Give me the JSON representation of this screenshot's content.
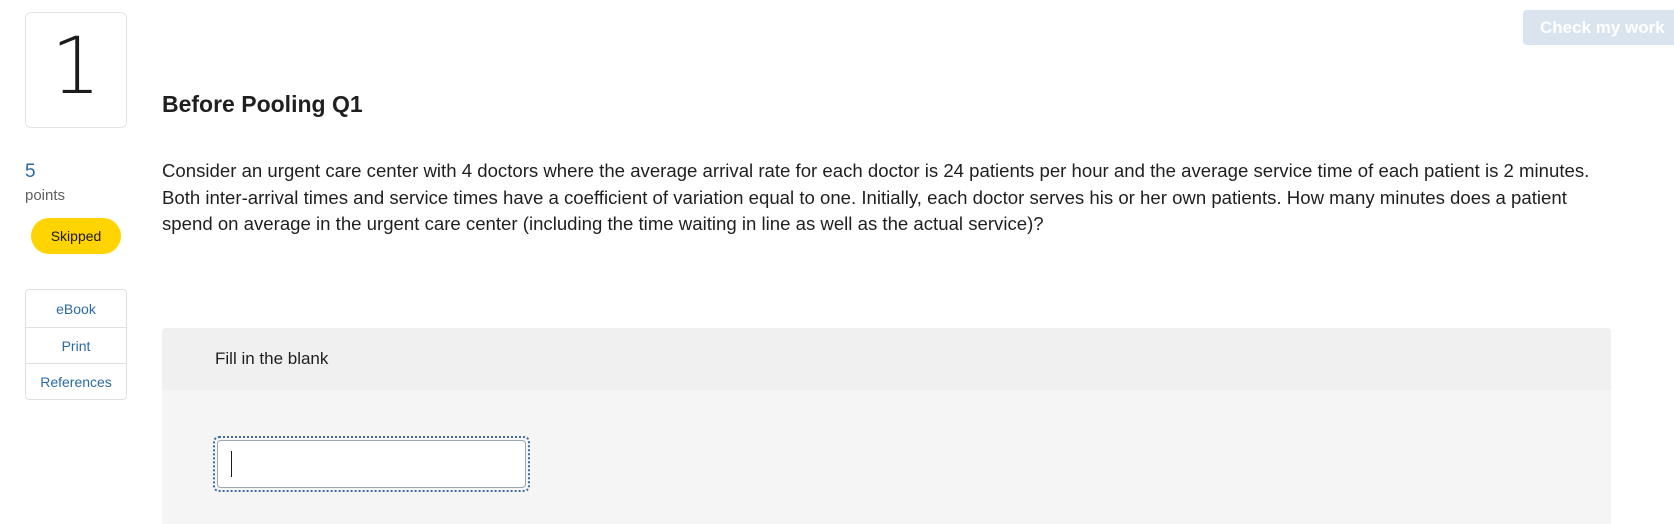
{
  "question": {
    "number": "1",
    "points_value": "5",
    "points_label": "points",
    "status": "Skipped",
    "title": "Before Pooling Q1",
    "text": "Consider an urgent care center with 4 doctors where the average arrival rate for each doctor is 24 patients per hour and the average service time of each patient is 2 minutes. Both inter-arrival times and service times have a coefficient of variation equal to one. Initially, each doctor serves his or her own patients. How many minutes does a patient spend on average in the urgent care center (including the time waiting in line as well as the actual service)?"
  },
  "tools": {
    "ebook": "eBook",
    "print": "Print",
    "references": "References"
  },
  "header": {
    "check_label": "Check my work"
  },
  "answer": {
    "section_label": "Fill in the blank",
    "value": ""
  },
  "colors": {
    "accent_link": "#2b6aa3",
    "status_badge": "#ffd400",
    "check_button_disabled": "#d9e4ef"
  }
}
